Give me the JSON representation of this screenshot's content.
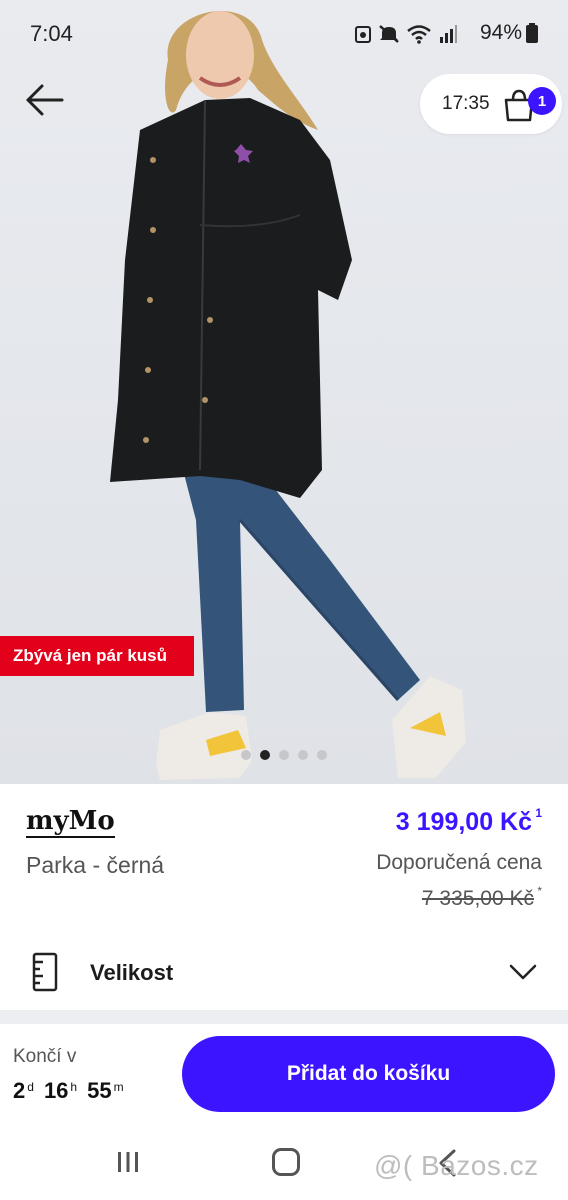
{
  "status_bar": {
    "time": "7:04",
    "battery": "94%"
  },
  "header": {
    "cart_timer": "17:35",
    "cart_count": "1"
  },
  "image": {
    "stock_badge": "Zbývá jen pár kusů",
    "carousel_count": 5,
    "carousel_active_index": 1
  },
  "product": {
    "brand": "myMo",
    "name": "Parka - černá",
    "price": "3 199,00 Kč",
    "price_footnote": "1",
    "rrp_label": "Doporučená cena",
    "rrp_value": "7 335,00 Kč",
    "rrp_footnote": "*"
  },
  "size_selector": {
    "label": "Velikost"
  },
  "offer": {
    "ends_label": "Končí v",
    "days": "2",
    "days_unit": "d",
    "hours": "16",
    "hours_unit": "h",
    "minutes": "55",
    "minutes_unit": "m",
    "add_to_cart": "Přidat do košíku"
  },
  "watermark": "@( Bazos.cz",
  "colors": {
    "accent": "#3d14ff",
    "badge_red": "#e2001a",
    "text_muted": "#555555"
  },
  "icons": {
    "back": "arrow-left-icon",
    "cart": "shopping-bag-icon",
    "size": "ruler-icon",
    "expand": "chevron-down-icon"
  }
}
